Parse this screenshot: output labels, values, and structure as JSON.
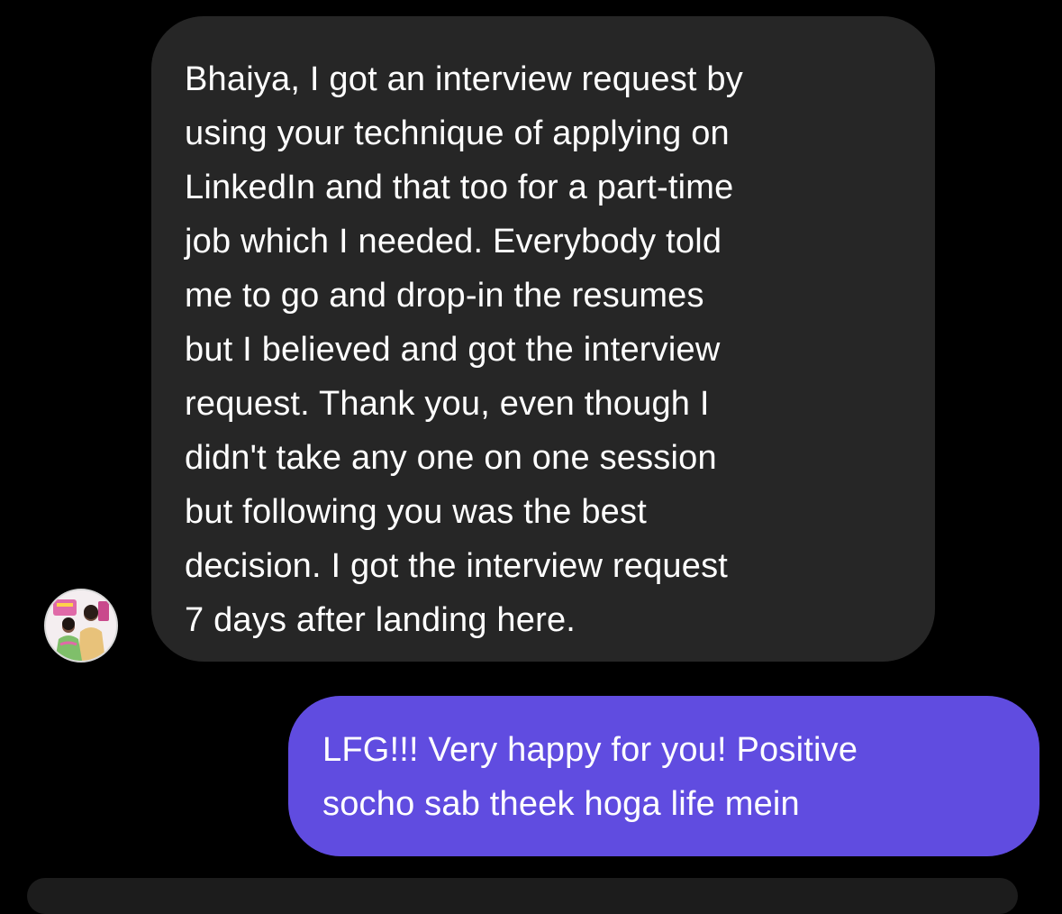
{
  "thread": {
    "incoming_message": "Bhaiya, I got an interview request by\nusing your technique of applying on\nLinkedIn and that too for a part-time\njob which I needed. Everybody told\nme to go and drop-in the resumes\nbut I believed and got the interview\nrequest. Thank you, even though I\ndidn't take any one on one session\nbut following you was the best\ndecision. I got the interview request\n7 days after landing here.",
    "outgoing_message": "LFG!!! Very happy for you! Positive\nsocho sab theek hoga life mein"
  },
  "colors": {
    "background": "#000000",
    "incoming_bubble": "#262626",
    "outgoing_bubble": "#604ce0",
    "text": "#ffffff"
  },
  "icons": {
    "avatar": "sender-avatar-photo"
  }
}
